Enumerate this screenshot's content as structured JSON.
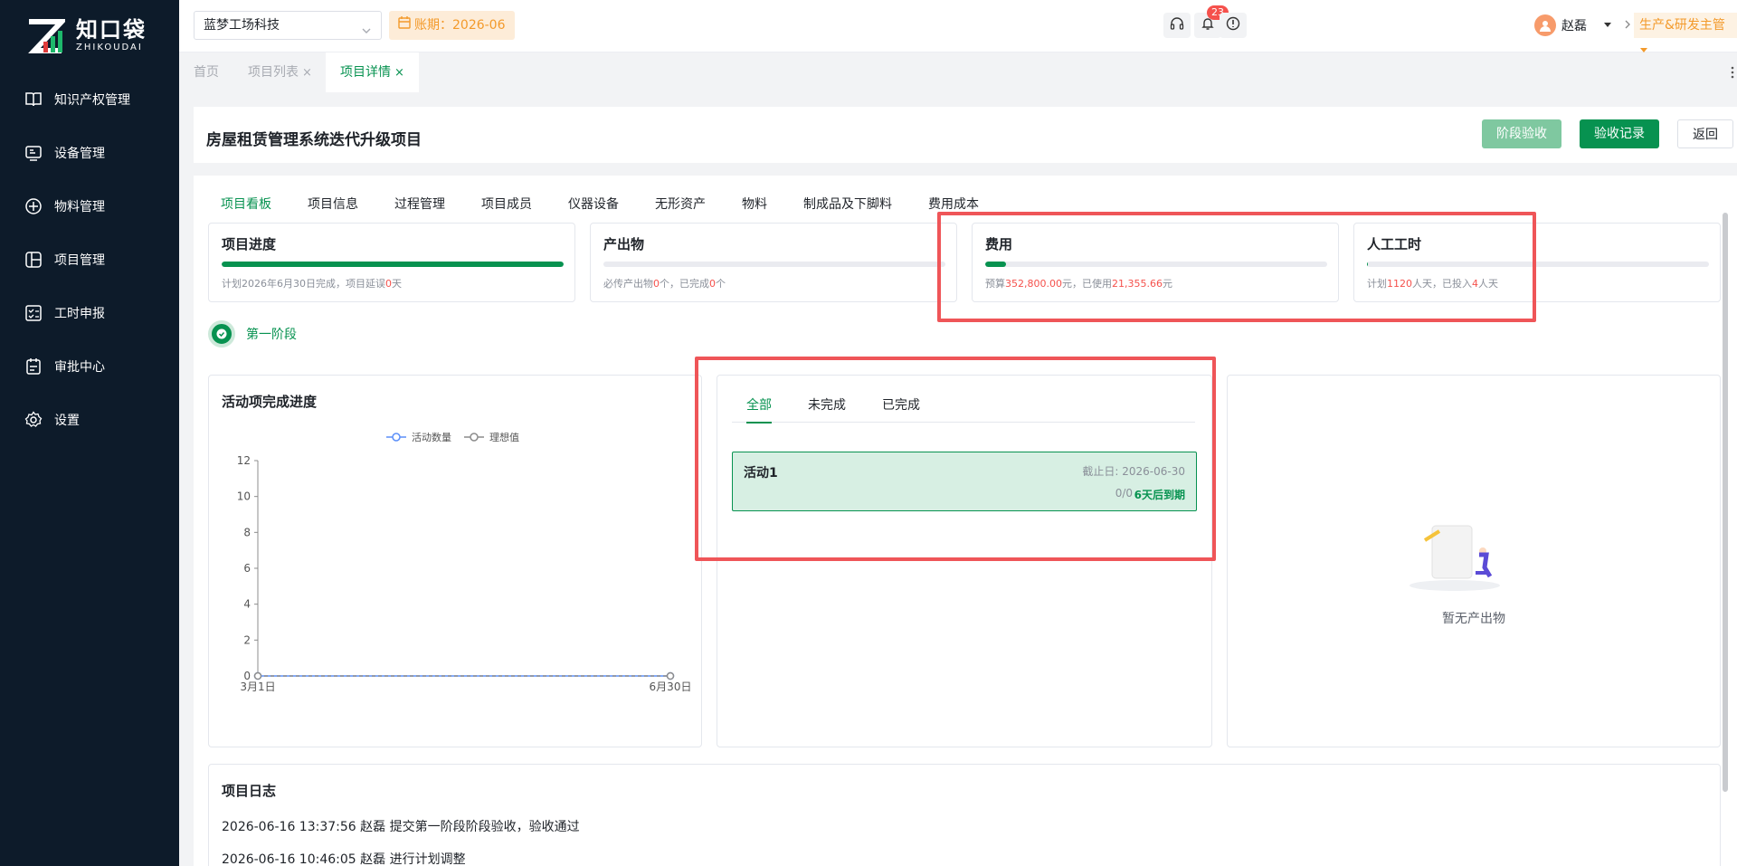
{
  "brand": {
    "title": "知口袋",
    "subtitle": "ZHIKOUDAI"
  },
  "sidebar": {
    "items": [
      {
        "label": "知识产权管理",
        "icon": "book-icon"
      },
      {
        "label": "设备管理",
        "icon": "device-icon"
      },
      {
        "label": "物料管理",
        "icon": "material-icon"
      },
      {
        "label": "项目管理",
        "icon": "project-icon"
      },
      {
        "label": "工时申报",
        "icon": "timesheet-icon"
      },
      {
        "label": "审批中心",
        "icon": "approval-icon"
      },
      {
        "label": "设置",
        "icon": "gear-icon"
      }
    ]
  },
  "header": {
    "company": "蓝梦工场科技",
    "period": "账期：2026-06",
    "notification_count": "23",
    "user_name": "赵磊",
    "role": "生产&研发主管"
  },
  "page_tabs": [
    {
      "label": "首页",
      "closable": false
    },
    {
      "label": "项目列表",
      "closable": true
    },
    {
      "label": "项目详情",
      "closable": true,
      "active": true
    }
  ],
  "close_glyph": "×",
  "project": {
    "title": "房屋租赁管理系统迭代升级项目",
    "buttons": {
      "stage_accept": "阶段验收",
      "accept_record": "验收记录",
      "back": "返回"
    }
  },
  "detail_tabs": [
    "项目看板",
    "项目信息",
    "过程管理",
    "项目成员",
    "仪器设备",
    "无形资产",
    "物料",
    "制成品及下脚料",
    "费用成本"
  ],
  "stats": {
    "progress": {
      "title": "项目进度",
      "fill": 1.0,
      "note_a": "计划2026年6月30日完成，项目延误",
      "note_b": "0",
      "note_c": "天"
    },
    "output": {
      "title": "产出物",
      "fill": 0,
      "note_a": "必传产出物",
      "note_b": "0",
      "note_c": "个，已完成",
      "note_d": "0",
      "note_e": "个"
    },
    "cost": {
      "title": "费用",
      "fill": 0.0605,
      "note_a": "预算",
      "note_b": "352,800.00",
      "note_c": "元，已使用",
      "note_d": "21,355.66",
      "note_e": "元"
    },
    "labor": {
      "title": "人工工时",
      "fill": 0.0036,
      "note_a": "计划",
      "note_b": "1120",
      "note_c": "人天，已投入",
      "note_d": "4",
      "note_e": "人天"
    }
  },
  "stage": {
    "label": "第一阶段"
  },
  "activity_panel": {
    "title": "活动项完成进度",
    "legend": [
      "活动数量",
      "理想值"
    ]
  },
  "chart_data": {
    "type": "line",
    "title": "活动项完成进度",
    "x": [
      "3月1日",
      "6月30日"
    ],
    "series": [
      {
        "name": "活动数量",
        "values": [
          0,
          0
        ]
      },
      {
        "name": "理想值",
        "values": [
          0,
          0
        ]
      }
    ],
    "y_ticks": [
      0,
      2,
      4,
      6,
      8,
      10,
      12
    ],
    "ylim": [
      0,
      12
    ],
    "legend_position": "top-center",
    "colors": {
      "活动数量": "#5b8ff9",
      "理想值": "#8c8c8c"
    }
  },
  "activity_list": {
    "tabs": [
      "全部",
      "未完成",
      "已完成"
    ],
    "items": [
      {
        "name": "活动1",
        "deadline": "截止日: 2026-06-30",
        "count": "0/0",
        "due": "6天后到期"
      }
    ]
  },
  "output_panel": {
    "empty_text": "暂无产出物"
  },
  "log": {
    "title": "项目日志",
    "entries": [
      "2026-06-16 13:37:56 赵磊 提交第一阶段阶段验收，验收通过",
      "2026-06-16 10:46:05 赵磊 进行计划调整"
    ]
  },
  "colors": {
    "primary": "#079250",
    "warning": "#f39a2b",
    "danger": "#f5514c",
    "sidebar_bg": "#0d1b2a",
    "highlight_box": "#ef5558"
  }
}
